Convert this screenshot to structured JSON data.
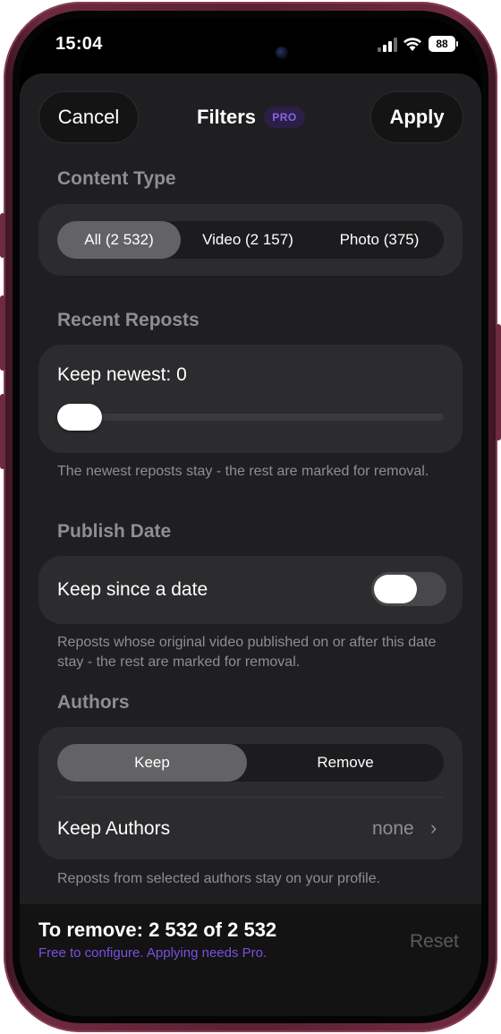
{
  "status_bar": {
    "time": "15:04",
    "battery": "88"
  },
  "nav": {
    "cancel_label": "Cancel",
    "title": "Filters",
    "pro_badge": "PRO",
    "apply_label": "Apply"
  },
  "content_type": {
    "title": "Content Type",
    "options": [
      "All (2 532)",
      "Video (2 157)",
      "Photo (375)"
    ],
    "selected": "All (2 532)"
  },
  "recent_reposts": {
    "title": "Recent Reposts",
    "label": "Keep newest: 0",
    "value": 0,
    "footnote": "The newest reposts stay - the rest are marked for removal."
  },
  "publish_date": {
    "title": "Publish Date",
    "toggle_label": "Keep since a date",
    "toggle_on": false,
    "footnote": "Reposts whose original video published on or after this date stay - the rest are marked for removal."
  },
  "authors": {
    "title": "Authors",
    "options": [
      "Keep",
      "Remove"
    ],
    "selected": "Keep",
    "row_label": "Keep Authors",
    "row_value": "none",
    "footnote": "Reposts from selected authors stay on your profile."
  },
  "footer": {
    "remove_count": "To remove: 2 532 of 2 532",
    "pro_note": "Free to configure. Applying needs Pro.",
    "reset_label": "Reset"
  },
  "colors": {
    "frame": "#6e2a3e",
    "background": "#1f1f21",
    "card": "#2c2c2e",
    "accent_purple": "#7a4fe0"
  }
}
